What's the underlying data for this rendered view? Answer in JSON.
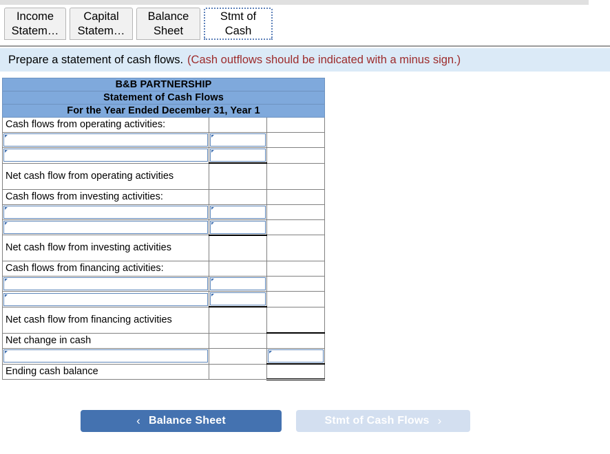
{
  "tabs": [
    {
      "line1": "Income",
      "line2": "Statem…",
      "active": false,
      "name": "tab-income-statement"
    },
    {
      "line1": "Capital",
      "line2": "Statem…",
      "active": false,
      "name": "tab-capital-statement"
    },
    {
      "line1": "Balance",
      "line2": "Sheet",
      "active": false,
      "name": "tab-balance-sheet"
    },
    {
      "line1": "Stmt of",
      "line2": "Cash",
      "active": true,
      "name": "tab-stmt-of-cash"
    }
  ],
  "instruction": {
    "main": "Prepare a statement of cash flows.",
    "note": "(Cash outflows should be indicated with a minus sign.)"
  },
  "statement": {
    "titles": [
      "B&B PARTNERSHIP",
      "Statement of Cash Flows",
      "For the Year Ended December 31, Year 1"
    ],
    "rows": [
      {
        "label": "Cash flows from operating activities:",
        "type": "label"
      },
      {
        "label": "",
        "type": "input",
        "col": "mid"
      },
      {
        "label": "",
        "type": "input",
        "col": "mid",
        "rule": "black-bottom"
      },
      {
        "label": "Net cash flow from operating activities",
        "type": "label",
        "two": true
      },
      {
        "label": "Cash flows from investing activities:",
        "type": "label"
      },
      {
        "label": "",
        "type": "input",
        "col": "mid"
      },
      {
        "label": "",
        "type": "input",
        "col": "mid",
        "rule": "black-bottom"
      },
      {
        "label": "Net cash flow from investing activities",
        "type": "label",
        "two": true
      },
      {
        "label": "Cash flows from financing activities:",
        "type": "label"
      },
      {
        "label": "",
        "type": "input",
        "col": "mid"
      },
      {
        "label": "",
        "type": "input",
        "col": "mid",
        "rule": "black-bottom"
      },
      {
        "label": "Net cash flow from financing activities",
        "type": "label",
        "two": true
      },
      {
        "label": "Net change in cash",
        "type": "label",
        "rule": "black-top-right"
      },
      {
        "label": "",
        "type": "input",
        "col": "right",
        "rule": "black-bottom-right"
      },
      {
        "label": "Ending cash balance",
        "type": "label",
        "rule": "double-bottom-right"
      }
    ]
  },
  "nav": {
    "prev_label": "Balance Sheet",
    "prev_chevron": "‹",
    "next_label": "Stmt of Cash Flows",
    "next_chevron": "›"
  },
  "colors": {
    "header_blue": "#7fa9dc",
    "banner_blue": "#dbeaf7",
    "note_red": "#9d2b2b",
    "button_active": "#4472b0",
    "button_disabled": "#d3dff0",
    "input_border": "#5b84b8"
  }
}
